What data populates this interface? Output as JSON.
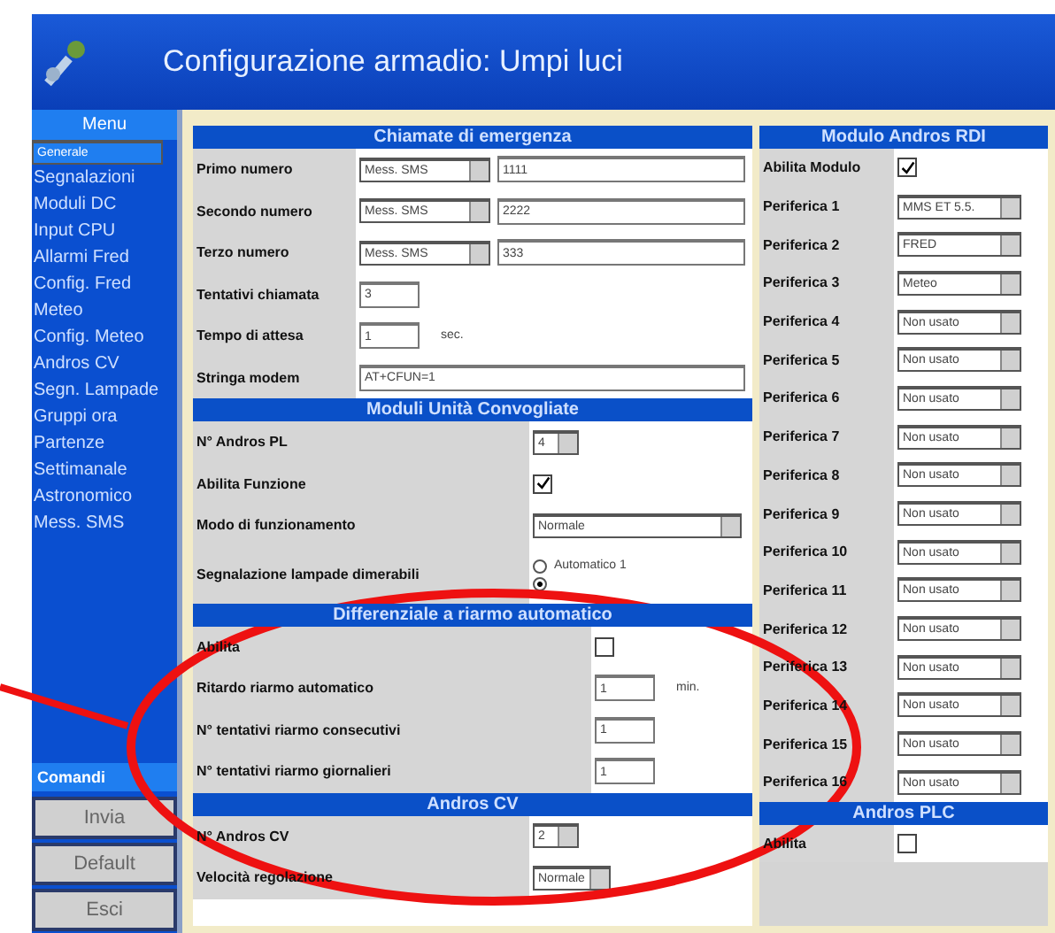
{
  "window": {
    "title": "Configurazione armadio: Umpi luci"
  },
  "sidebar": {
    "header": "Menu",
    "items": [
      {
        "label": "Generale",
        "selected": true
      },
      {
        "label": "Segnalazioni",
        "selected": false
      },
      {
        "label": "Moduli DC",
        "selected": false
      },
      {
        "label": "Input CPU",
        "selected": false
      },
      {
        "label": "Allarmi Fred",
        "selected": false
      },
      {
        "label": "Config. Fred",
        "selected": false
      },
      {
        "label": "Meteo",
        "selected": false
      },
      {
        "label": "Config. Meteo",
        "selected": false
      },
      {
        "label": "Andros CV",
        "selected": false
      },
      {
        "label": "Segn. Lampade",
        "selected": false
      },
      {
        "label": "Gruppi ora",
        "selected": false
      },
      {
        "label": "Partenze",
        "selected": false
      },
      {
        "label": "Settimanale",
        "selected": false
      },
      {
        "label": "Astronomico",
        "selected": false
      },
      {
        "label": "Mess. SMS",
        "selected": false
      }
    ],
    "commands_header": "Comandi",
    "buttons": [
      "Invia",
      "Default",
      "Esci"
    ]
  },
  "left_sections": [
    {
      "title": "Chiamate di emergenza",
      "rows": [
        {
          "label": "Primo numero",
          "kind": "select_input",
          "select": "Mess. SMS",
          "value": "1111"
        },
        {
          "label": "Secondo numero",
          "kind": "select_input",
          "select": "Mess. SMS",
          "value": "2222"
        },
        {
          "label": "Terzo numero",
          "kind": "select_input",
          "select": "Mess. SMS",
          "value": "333"
        },
        {
          "label": "Tentativi chiamata",
          "kind": "input",
          "value": "3"
        },
        {
          "label": "Tempo di attesa",
          "kind": "input",
          "value": "1",
          "unit": "sec."
        },
        {
          "label": "Stringa modem",
          "kind": "wide_input",
          "value": "AT+CFUN=1"
        }
      ]
    },
    {
      "title": "Moduli Unità Convogliate",
      "rows": [
        {
          "label": "N° Andros PL",
          "kind": "select",
          "select": "4"
        },
        {
          "label": "Abilita Funzione",
          "kind": "checkbox",
          "checked": true
        },
        {
          "label": "Modo di funzionamento",
          "kind": "long_select",
          "select": "Normale"
        },
        {
          "label": "Segnalazione lampade dimerabili",
          "kind": "radios",
          "options": [
            {
              "label": "Automatico 1",
              "selected": false
            },
            {
              "selected": true
            }
          ]
        }
      ]
    },
    {
      "title": "Differenziale a riarmo automatico",
      "rows": [
        {
          "label": "Abilita",
          "kind": "checkbox",
          "checked": false
        },
        {
          "label": "Ritardo riarmo automatico",
          "kind": "input",
          "value": "1",
          "unit": "min."
        },
        {
          "label": "N° tentativi riarmo consecutivi",
          "kind": "input",
          "value": "1"
        },
        {
          "label": "N° tentativi riarmo giornalieri",
          "kind": "input",
          "value": "1"
        }
      ]
    },
    {
      "title": "Andros CV",
      "rows": [
        {
          "label": "N° Andros CV",
          "kind": "select",
          "select": "2"
        },
        {
          "label": "Velocità regolazione",
          "kind": "select",
          "select": "Normale"
        }
      ]
    }
  ],
  "right_sections": [
    {
      "title": "Modulo Andros RDI",
      "rows": [
        {
          "label": "Abilita Modulo",
          "kind": "checkbox",
          "checked": true
        },
        {
          "label": "Periferica 1",
          "kind": "select",
          "select": "MMS ET 5.5."
        },
        {
          "label": "Periferica 2",
          "kind": "select",
          "select": "FRED"
        },
        {
          "label": "Periferica 3",
          "kind": "select",
          "select": "Meteo"
        },
        {
          "label": "Periferica 4",
          "kind": "select",
          "select": "Non usato"
        },
        {
          "label": "Periferica 5",
          "kind": "select",
          "select": "Non usato"
        },
        {
          "label": "Periferica 6",
          "kind": "select",
          "select": "Non usato"
        },
        {
          "label": "Periferica 7",
          "kind": "select",
          "select": "Non usato"
        },
        {
          "label": "Periferica 8",
          "kind": "select",
          "select": "Non usato"
        },
        {
          "label": "Periferica 9",
          "kind": "select",
          "select": "Non usato"
        },
        {
          "label": "Periferica 10",
          "kind": "select",
          "select": "Non usato"
        },
        {
          "label": "Periferica 11",
          "kind": "select",
          "select": "Non usato"
        },
        {
          "label": "Periferica 12",
          "kind": "select",
          "select": "Non usato"
        },
        {
          "label": "Periferica 13",
          "kind": "select",
          "select": "Non usato"
        },
        {
          "label": "Periferica 14",
          "kind": "select",
          "select": "Non usato"
        },
        {
          "label": "Periferica 15",
          "kind": "select",
          "select": "Non usato"
        },
        {
          "label": "Periferica 16",
          "kind": "select",
          "select": "Non usato"
        }
      ]
    },
    {
      "title": "Andros PLC",
      "rows": [
        {
          "label": "Abilita",
          "kind": "checkbox",
          "checked": false
        }
      ]
    }
  ],
  "annotation": {
    "kind": "ellipse",
    "color": "#ee1111"
  }
}
